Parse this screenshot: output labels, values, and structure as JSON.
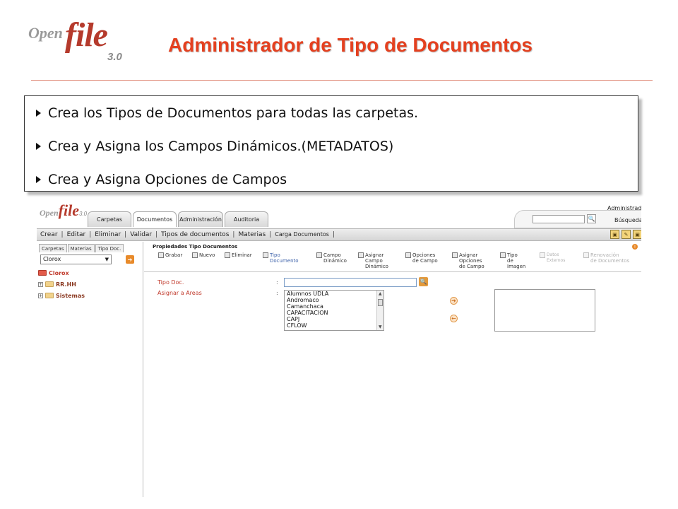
{
  "slide": {
    "logo": {
      "open": "Open",
      "file": "file",
      "version": "3.0"
    },
    "title": "Administrador de Tipo de Documentos",
    "bullets": [
      "Crea los Tipos de Documentos para todas las carpetas.",
      "Crea y Asigna los Campos Dinámicos.(METADATOS)",
      "Crea y Asigna Opciones de Campos"
    ]
  },
  "app": {
    "logo": {
      "open": "Open",
      "file": "file",
      "version": "3.0"
    },
    "tabs": [
      "Carpetas",
      "Documentos",
      "Administración",
      "Auditoria"
    ],
    "active_tab": "Documentos",
    "user": "Administrador",
    "search_label": "Búsqueda",
    "search_button": "🔍",
    "menu": [
      "Crear",
      "Editar",
      "Eliminar",
      "Validar",
      "Tipos de documentos",
      "Materias",
      "Carga Documentos"
    ],
    "menu_separator": "|",
    "left_panel": {
      "tabs": [
        "Carpetas",
        "Materias",
        "Tipo Doc."
      ],
      "selected_client": "Clorox",
      "dropdown_arrow": "▼",
      "go_button": "➔",
      "tree": [
        {
          "label": "Clorox",
          "expander": ""
        },
        {
          "label": "RR.HH",
          "expander": "+"
        },
        {
          "label": "Sistemas",
          "expander": "+"
        }
      ]
    },
    "main": {
      "section_header": "Propiedades Tipo Documentos",
      "toolbar": [
        {
          "label": "Grabar",
          "state": "normal"
        },
        {
          "label": "Nuevo",
          "state": "normal"
        },
        {
          "label": "Eliminar",
          "state": "normal"
        },
        {
          "label": "Tipo\nDocumento",
          "state": "active"
        },
        {
          "label": "Campo\nDinámico",
          "state": "normal"
        },
        {
          "label": "Asignar\nCampo\nDinámico",
          "state": "normal"
        },
        {
          "label": "Opciones\nde Campo",
          "state": "normal"
        },
        {
          "label": "Asignar\nOpciones\nde Campo",
          "state": "normal"
        },
        {
          "label": "Tipo\nde\nImagen",
          "state": "normal"
        },
        {
          "label": "Datos\nExternos",
          "state": "disabled"
        },
        {
          "label": "Renovación\nde Documentos",
          "state": "disabled"
        }
      ],
      "fields": {
        "tipo_doc_label": "Tipo Doc.",
        "asignar_areas_label": "Asignar a Areas",
        "colon": ":",
        "tipo_doc_value": ""
      },
      "areas_available": [
        "Alumnos UDLA",
        "Andromaco",
        "Camanchaca",
        "CAPACITACION",
        "CAPJ",
        "CFLOW"
      ],
      "scroll_up": "▲",
      "scroll_down": "▼",
      "move_right": "➔",
      "move_left": "←",
      "info": "!"
    }
  }
}
